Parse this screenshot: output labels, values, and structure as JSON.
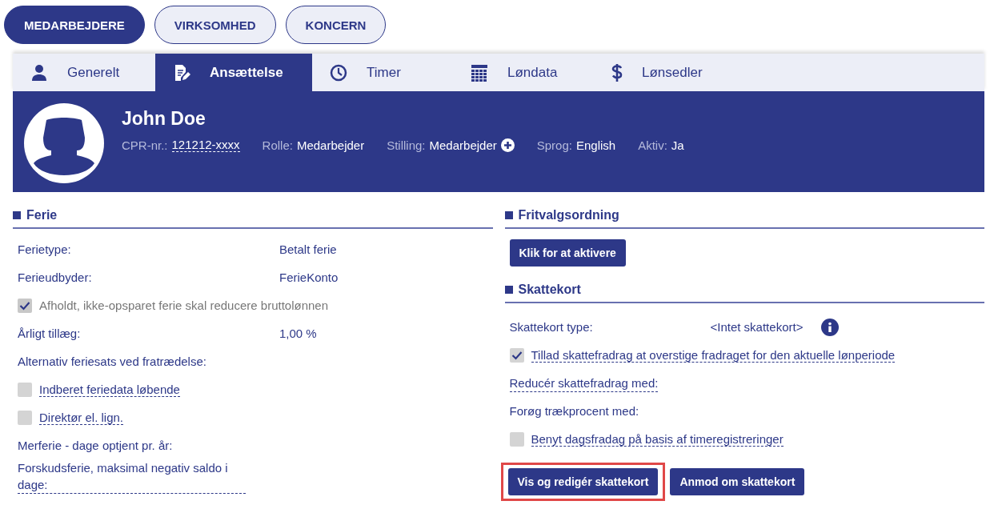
{
  "scopes": [
    {
      "label": "MEDARBEJDERE",
      "selected": true
    },
    {
      "label": "VIRKSOMHED",
      "selected": false
    },
    {
      "label": "KONCERN",
      "selected": false
    }
  ],
  "tabs": [
    {
      "label": "Generelt",
      "selected": false
    },
    {
      "label": "Ansættelse",
      "selected": true
    },
    {
      "label": "Timer",
      "selected": false
    },
    {
      "label": "Løndata",
      "selected": false
    },
    {
      "label": "Lønsedler",
      "selected": false
    }
  ],
  "employee": {
    "name": "John Doe",
    "facts": [
      {
        "label": "CPR-nr.:",
        "value": "121212-xxxx",
        "help": true,
        "add_button": false
      },
      {
        "label": "Rolle:",
        "value": "Medarbejder",
        "help": false,
        "add_button": false
      },
      {
        "label": "Stilling:",
        "value": "Medarbejder",
        "help": false,
        "add_button": true
      },
      {
        "label": "Sprog:",
        "value": "English",
        "help": false,
        "add_button": false
      },
      {
        "label": "Aktiv:",
        "value": "Ja",
        "help": false,
        "add_button": false
      }
    ]
  },
  "ferie": {
    "title": "Ferie",
    "rows": [
      {
        "kind": "field",
        "label": "Ferietype:",
        "value": "Betalt ferie",
        "help": false
      },
      {
        "kind": "field",
        "label": "Ferieudbyder:",
        "value": "FerieKonto",
        "help": false
      },
      {
        "kind": "checkbox",
        "label": "Afholdt, ikke-opsparet ferie skal reducere bruttolønnen",
        "checked": true,
        "disabled": true,
        "help": false
      },
      {
        "kind": "field",
        "label": "Årligt tillæg:",
        "value": "1,00 %",
        "help": false
      },
      {
        "kind": "label",
        "label": "Alternativ feriesats ved fratrædelse:",
        "help": false
      },
      {
        "kind": "checkbox",
        "label": "Indberet feriedata løbende",
        "checked": false,
        "disabled": false,
        "help": true
      },
      {
        "kind": "checkbox",
        "label": "Direktør el. lign.",
        "checked": false,
        "disabled": false,
        "help": true
      },
      {
        "kind": "label",
        "label": "Merferie - dage optjent pr. år:",
        "help": false
      },
      {
        "kind": "label",
        "label": "Forskudsferie, maksimal negativ saldo i dage:",
        "help": true
      }
    ]
  },
  "fritvalg": {
    "title": "Fritvalgsordning",
    "button": "Klik for at aktivere"
  },
  "skattekort": {
    "title": "Skattekort",
    "rows": [
      {
        "kind": "field",
        "label": "Skattekort type:",
        "value": "<Intet skattekort>",
        "help": false,
        "info": true
      },
      {
        "kind": "checkbox",
        "label": "Tillad skattefradrag at overstige fradraget for den aktuelle lønperiode",
        "checked": true,
        "disabled": false,
        "help": true
      },
      {
        "kind": "label",
        "label": "Reducér skattefradrag med:",
        "help": true
      },
      {
        "kind": "label",
        "label": "Forøg trækprocent med:",
        "help": false
      },
      {
        "kind": "checkbox",
        "label": "Benyt dagsfradag på basis af timeregistreringer",
        "checked": false,
        "disabled": false,
        "help": true
      }
    ],
    "buttons": [
      {
        "label": "Vis og redigér skattekort",
        "highlighted": true
      },
      {
        "label": "Anmod om skattekort",
        "highlighted": false
      }
    ]
  }
}
